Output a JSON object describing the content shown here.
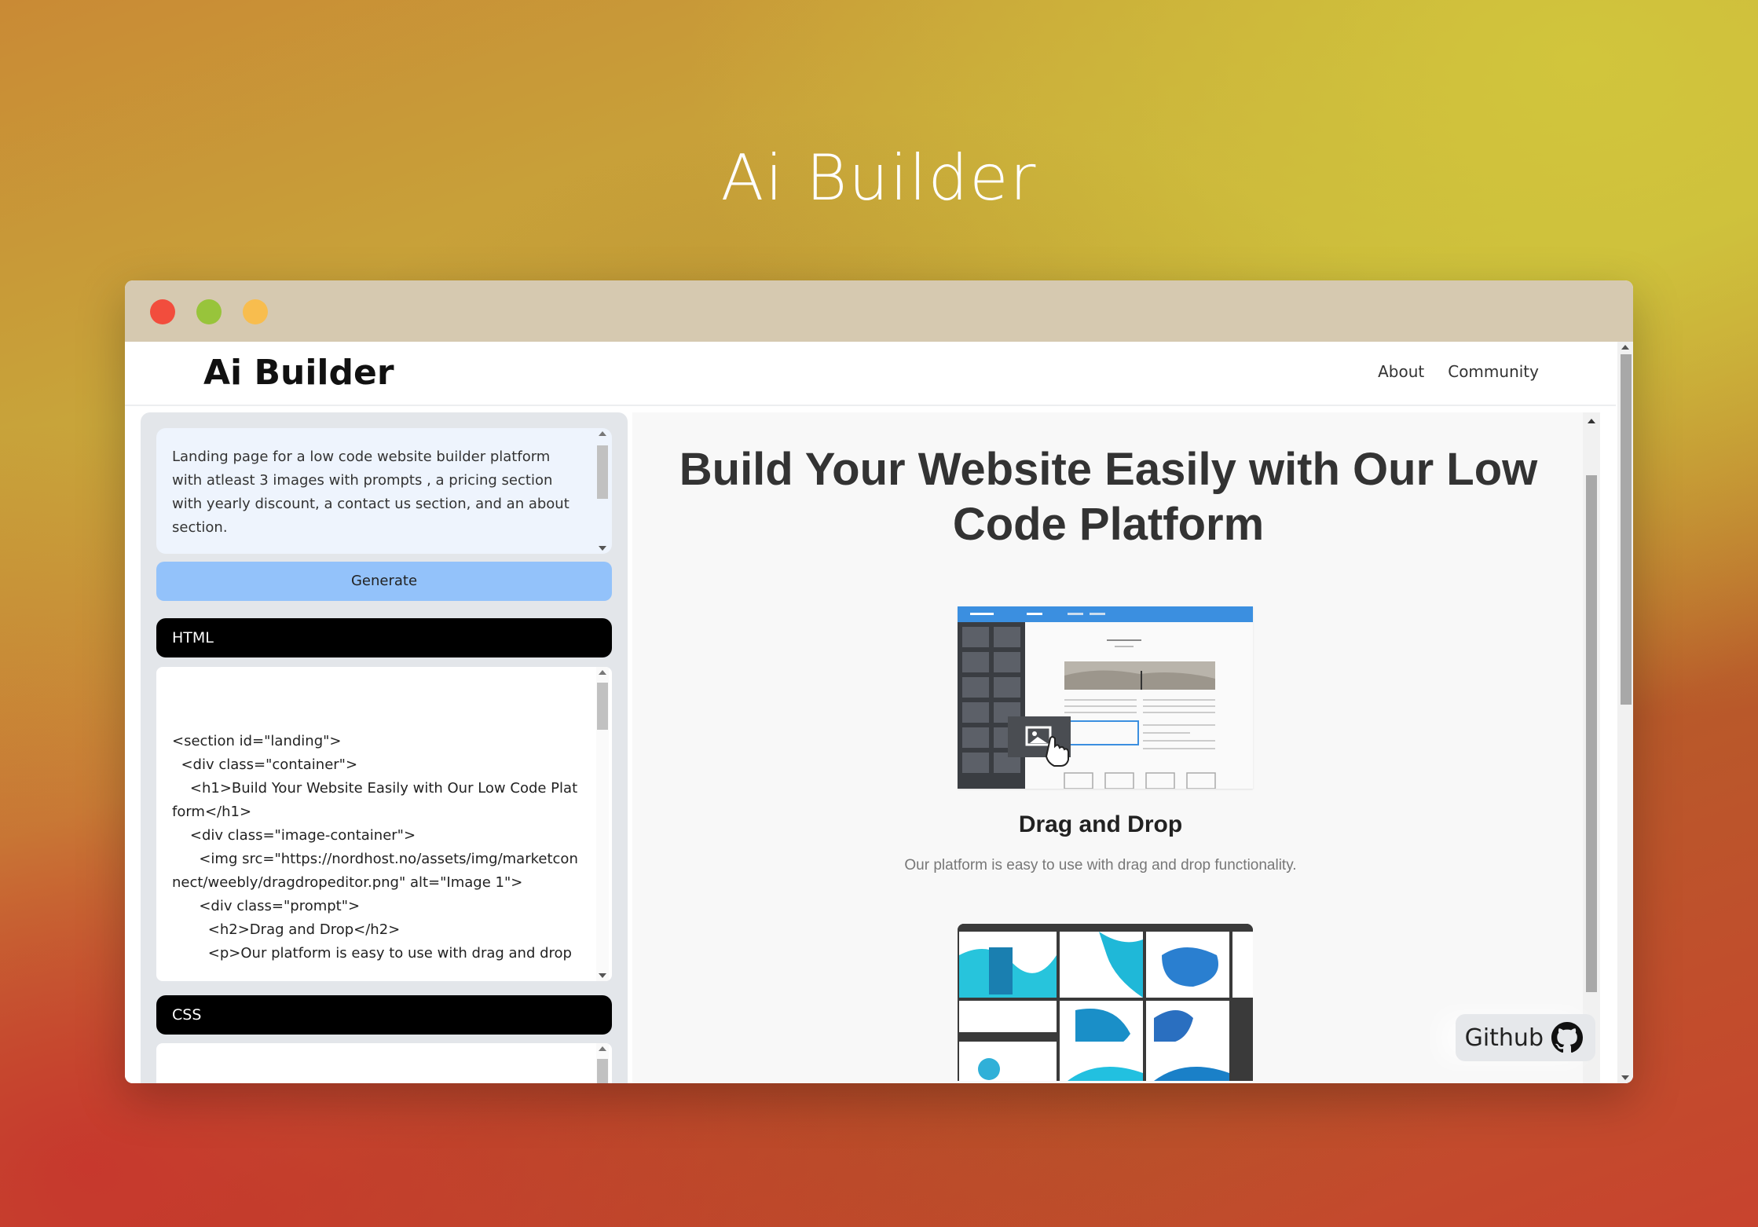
{
  "hero": {
    "title": "Ai Builder"
  },
  "app": {
    "brand": "Ai Builder",
    "nav": [
      {
        "label": "About"
      },
      {
        "label": "Community"
      }
    ]
  },
  "left": {
    "prompt": "Landing page for a low code website builder platform with atleast 3 images with prompts , a pricing section with yearly discount, a contact us section, and an about section.",
    "generate_label": "Generate",
    "html_label": "HTML",
    "html_code": "<section id=\"landing\">\n  <div class=\"container\">\n    <h1>Build Your Website Easily with Our Low Code Platform</h1>\n    <div class=\"image-container\">\n      <img src=\"https://nordhost.no/assets/img/marketconnect/weebly/dragdropeditor.png\" alt=\"Image 1\">\n      <div class=\"prompt\">\n        <h2>Drag and Drop</h2>\n        <p>Our platform is easy to use with drag and drop",
    "css_label": "CSS"
  },
  "preview": {
    "title": "Build Your Website Easily with Our Low Code Platform",
    "card_title": "Drag and Drop",
    "card_text": "Our platform is easy to use with drag and drop functionality."
  },
  "github": {
    "label": "Github",
    "icon": "github-icon"
  },
  "colors": {
    "close": "#f24d3d",
    "minimize": "#98c43b",
    "maximize": "#f8bd4e",
    "generate_button": "#93c2fa",
    "titlebar": "#d6c9b0"
  }
}
